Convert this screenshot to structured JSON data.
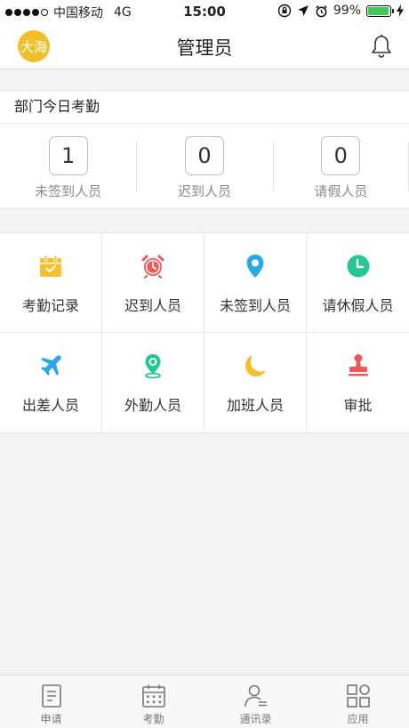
{
  "status_bar": {
    "carrier": "中国移动",
    "network": "4G",
    "time": "15:00",
    "battery": "99%",
    "battery_level": 0.99,
    "signal_bars": 4
  },
  "navbar": {
    "avatar_text": "大海",
    "title": "管理员",
    "bell_icon": "bell-icon"
  },
  "attendance": {
    "header": "部门今日考勤",
    "stats": [
      {
        "value": "1",
        "label": "未签到人员"
      },
      {
        "value": "0",
        "label": "迟到人员"
      },
      {
        "value": "0",
        "label": "请假人员"
      }
    ]
  },
  "grid": {
    "items": [
      {
        "label": "考勤记录",
        "icon": "calendar-check-icon",
        "color": "#f5c02a"
      },
      {
        "label": "迟到人员",
        "icon": "alarm-clock-icon",
        "color": "#ee5a5a"
      },
      {
        "label": "未签到人员",
        "icon": "location-pin-icon",
        "color": "#2aa8e8"
      },
      {
        "label": "请休假人员",
        "icon": "clock-icon",
        "color": "#22c796"
      },
      {
        "label": "出差人员",
        "icon": "airplane-icon",
        "color": "#2aa8e8"
      },
      {
        "label": "外勤人员",
        "icon": "map-pin-icon",
        "color": "#22c796"
      },
      {
        "label": "加班人员",
        "icon": "moon-icon",
        "color": "#f5c02a"
      },
      {
        "label": "审批",
        "icon": "stamp-icon",
        "color": "#ee5a5a"
      }
    ]
  },
  "tabbar": {
    "items": [
      {
        "label": "申请",
        "icon": "document-icon"
      },
      {
        "label": "考勤",
        "icon": "calendar-icon"
      },
      {
        "label": "通讯录",
        "icon": "contacts-icon"
      },
      {
        "label": "应用",
        "icon": "apps-grid-icon"
      }
    ]
  }
}
